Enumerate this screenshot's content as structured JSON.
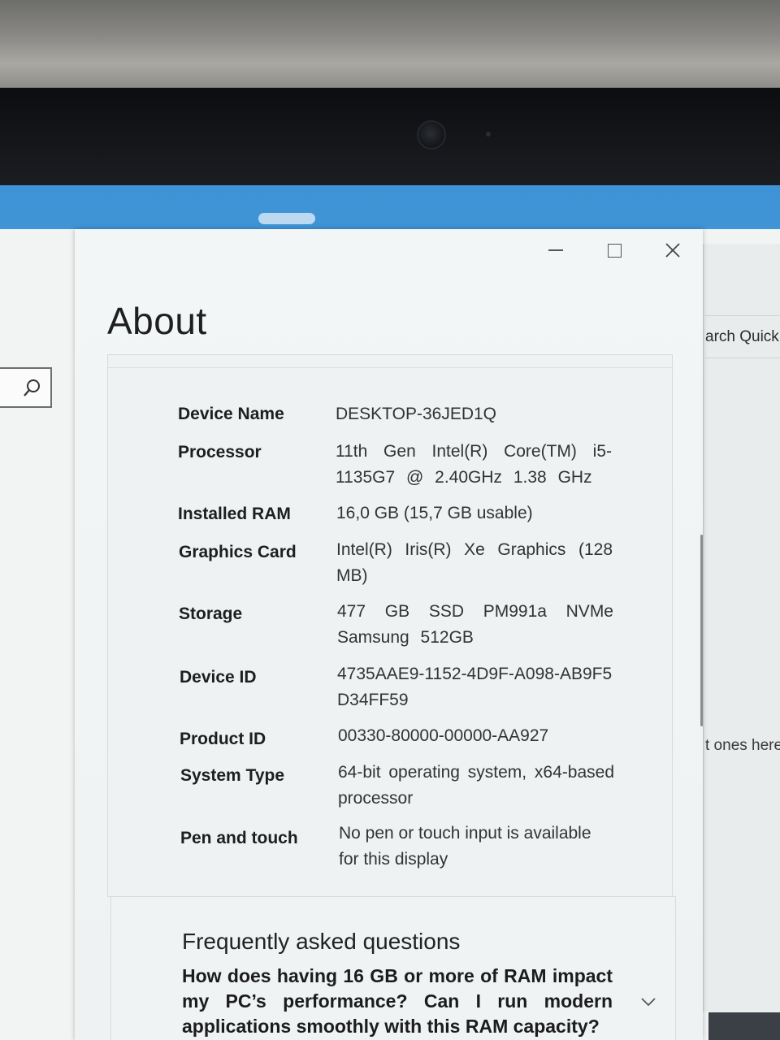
{
  "window": {
    "title": "About",
    "controls": {
      "minimize": "minimize",
      "maximize": "maximize",
      "close": "close"
    }
  },
  "background": {
    "right_text_top": "arch Quick",
    "right_text_bottom": "t ones here"
  },
  "specs": [
    {
      "label": "Device Name",
      "value": "DESKTOP-36JED1Q"
    },
    {
      "label": "Processor",
      "value": "11th Gen Intel(R) Core(TM) i5-1135G7 @ 2.40GHz 1.38 GHz"
    },
    {
      "label": "Installed RAM",
      "value": "16,0 GB (15,7 GB usable)"
    },
    {
      "label": "Graphics Card",
      "value": "Intel(R) Iris(R) Xe Graphics (128 MB)"
    },
    {
      "label": "Storage",
      "value": "477 GB SSD PM991a NVMe Samsung 512GB"
    },
    {
      "label": "Device ID",
      "value": "4735AAE9-1152-4D9F-A098-AB9F5D34FF59"
    },
    {
      "label": "Product ID",
      "value": "00330-80000-00000-AA927"
    },
    {
      "label": "System Type",
      "value": "64-bit operating system, x64-based processor"
    },
    {
      "label": "Pen and touch",
      "value": "No pen or touch input is available for this display"
    }
  ],
  "faq": {
    "heading": "Frequently asked questions",
    "question": "How does having 16 GB or more of RAM impact my PC’s performance? Can I run modern applications smoothly with this RAM capacity?"
  },
  "icons": {
    "search": "search-icon",
    "chevron": "chevron-down-icon"
  }
}
